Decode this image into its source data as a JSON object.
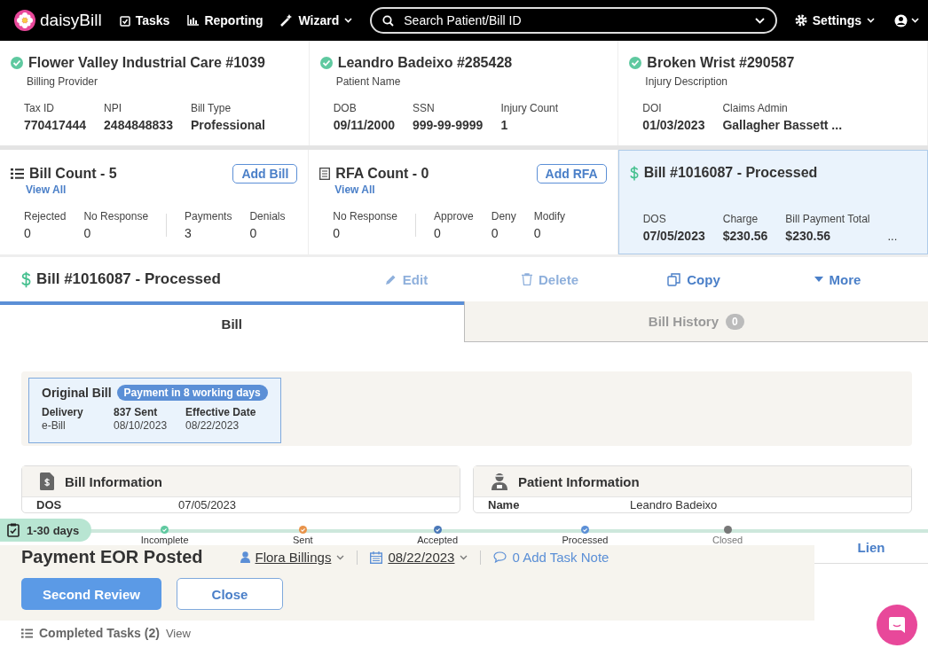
{
  "nav": {
    "logo": "daisyBill",
    "items": [
      {
        "label": "Tasks",
        "kind": "tasks",
        "dropdown": false
      },
      {
        "label": "Reporting",
        "kind": "chart",
        "dropdown": false
      },
      {
        "label": "Wizard",
        "kind": "wand",
        "dropdown": true
      }
    ],
    "search": {
      "placeholder": "Search Patient/Bill ID"
    },
    "settings": "Settings"
  },
  "summary": [
    {
      "title": "Flower Valley Industrial Care #1039",
      "subtitle": "Billing Provider",
      "verified": true,
      "fields": [
        {
          "label": "Tax ID",
          "value": "770417444"
        },
        {
          "label": "NPI",
          "value": "2484848833"
        },
        {
          "label": "Bill Type",
          "value": "Professional"
        }
      ]
    },
    {
      "title": "Leandro Badeixo #285428",
      "subtitle": "Patient Name",
      "verified": true,
      "fields": [
        {
          "label": "DOB",
          "value": "09/11/2000"
        },
        {
          "label": "SSN",
          "value": "999-99-9999"
        },
        {
          "label": "Injury Count",
          "value": "1"
        }
      ]
    },
    {
      "title": "Broken Wrist #290587",
      "subtitle": "Injury Description",
      "verified": true,
      "fields": [
        {
          "label": "DOI",
          "value": "01/03/2023"
        },
        {
          "label": "Claims Admin",
          "value": "Gallagher Bassett ..."
        }
      ]
    }
  ],
  "counts": [
    {
      "kind": "list",
      "title": "Bill Count - 5",
      "action": "Add Bill",
      "link": "View All",
      "groups": [
        [
          {
            "label": "Rejected",
            "value": "0"
          },
          {
            "label": "No Response",
            "value": "0"
          }
        ],
        [
          {
            "label": "Payments",
            "value": "3"
          },
          {
            "label": "Denials",
            "value": "0"
          }
        ]
      ]
    },
    {
      "kind": "form",
      "title": "RFA Count - 0",
      "action": "Add RFA",
      "link": "View All",
      "groups": [
        [
          {
            "label": "No Response",
            "value": "0"
          }
        ],
        [
          {
            "label": "Approve",
            "value": "0"
          },
          {
            "label": "Deny",
            "value": "0"
          },
          {
            "label": "Modify",
            "value": "0"
          }
        ]
      ]
    },
    {
      "kind": "bill",
      "title": "Bill #1016087 - Processed",
      "groups": [
        [
          {
            "label": "DOS",
            "value": "07/05/2023"
          },
          {
            "label": "Charge",
            "value": "$230.56"
          },
          {
            "label": "Bill Payment Total",
            "value": "$230.56"
          }
        ]
      ],
      "more": "..."
    }
  ],
  "bill_header": {
    "title": "Bill #1016087 - Processed",
    "actions": [
      {
        "label": "Edit",
        "kind": "pencil",
        "disabled": true
      },
      {
        "label": "Delete",
        "kind": "trash",
        "disabled": true
      },
      {
        "label": "Copy",
        "kind": "copy",
        "disabled": false
      },
      {
        "label": "More",
        "kind": "caret",
        "disabled": false
      }
    ]
  },
  "tabs": [
    {
      "label": "Bill",
      "selected": true
    },
    {
      "label": "Bill History",
      "selected": false,
      "badge": "0"
    }
  ],
  "original_bill": {
    "title": "Original Bill",
    "badge": "Payment in 8 working days",
    "fields": [
      {
        "label": "Delivery",
        "value": "e-Bill"
      },
      {
        "label": "837 Sent",
        "value": "08/10/2023"
      },
      {
        "label": "Effective Date",
        "value": "08/22/2023"
      }
    ]
  },
  "sections": [
    {
      "title": "Bill Information",
      "kind": "bill",
      "rows": [
        {
          "label": "DOS",
          "value": "07/05/2023"
        }
      ]
    },
    {
      "title": "Patient Information",
      "kind": "patient",
      "rows": [
        {
          "label": "Name",
          "value": "Leandro Badeixo"
        }
      ]
    }
  ],
  "task": {
    "age": "1-30 days",
    "steps": [
      {
        "label": "Incomplete",
        "color": "#5fc9a0",
        "done": true
      },
      {
        "label": "Sent",
        "color": "#e8934a",
        "done": true
      },
      {
        "label": "Accepted",
        "color": "#4a78b8",
        "done": true
      },
      {
        "label": "Processed",
        "color": "#5b8fd6",
        "done": true
      },
      {
        "label": "Closed",
        "color": "#777777",
        "done": false
      }
    ],
    "title": "Payment EOR Posted",
    "assignee": "Flora Billings",
    "date": "08/22/2023",
    "note": "0 Add Task Note",
    "buttons": [
      {
        "label": "Second Review",
        "primary": true
      },
      {
        "label": "Close",
        "primary": false
      }
    ],
    "completed": "Completed Tasks (2)",
    "view": "View"
  },
  "side_tab": "Lien"
}
